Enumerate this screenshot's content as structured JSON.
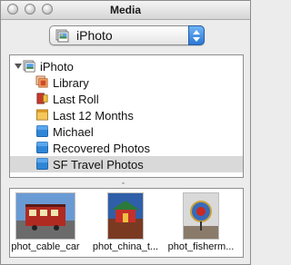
{
  "window": {
    "title": "Media"
  },
  "popup": {
    "selected": "iPhoto"
  },
  "sources": {
    "root_label": "iPhoto",
    "items": [
      {
        "label": "Library",
        "icon": "library-icon"
      },
      {
        "label": "Last Roll",
        "icon": "film-roll-icon"
      },
      {
        "label": "Last 12 Months",
        "icon": "calendar-icon"
      },
      {
        "label": "Michael",
        "icon": "album-icon"
      },
      {
        "label": "Recovered Photos",
        "icon": "album-icon"
      },
      {
        "label": "SF Travel Photos",
        "icon": "album-icon",
        "selected": true
      }
    ]
  },
  "splitter": {
    "glyph": "ˆ"
  },
  "photos": [
    {
      "caption": "phot_cable_car"
    },
    {
      "caption": "phot_china_t..."
    },
    {
      "caption": "phot_fisherm..."
    }
  ],
  "colors": {
    "folder_blue": "#2f86d6",
    "selection": "#d9d9d9",
    "popup_accent": "#2a77d6"
  }
}
